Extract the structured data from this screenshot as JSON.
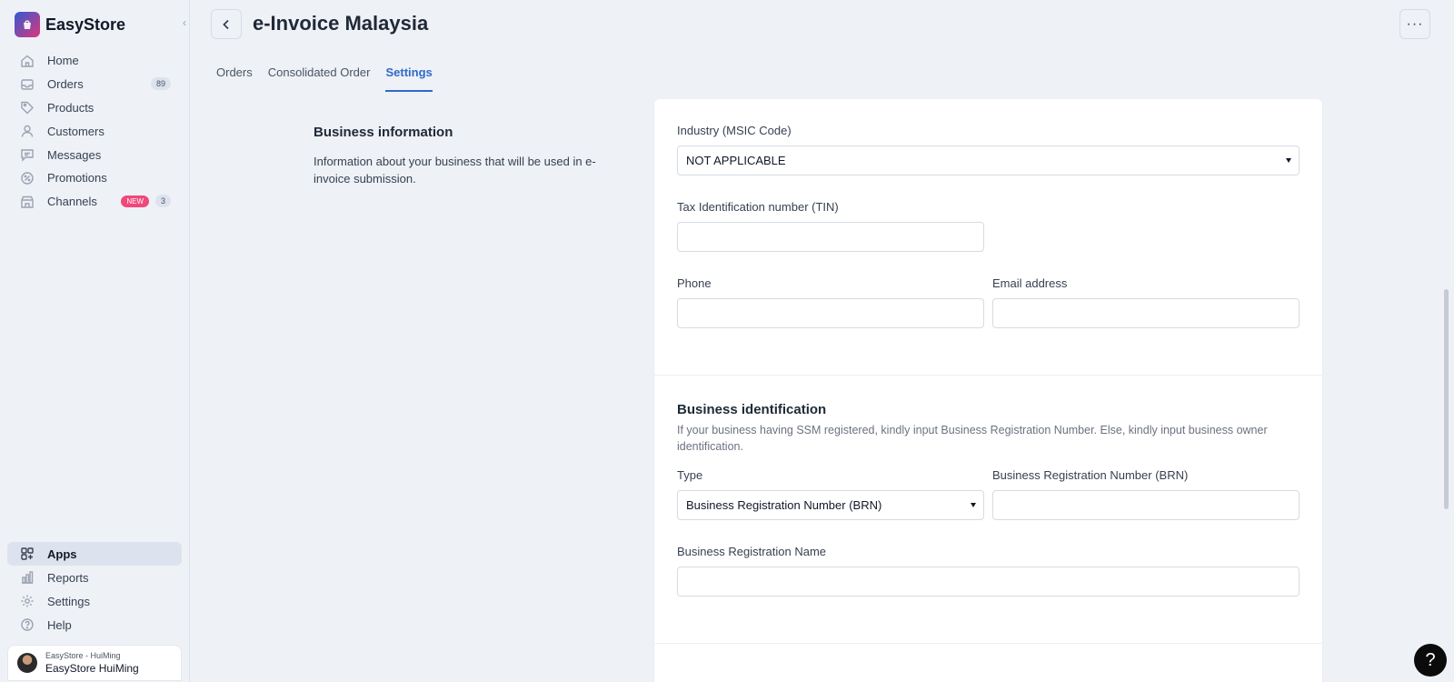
{
  "brand": {
    "name": "EasyStore"
  },
  "sidebar": {
    "items": [
      {
        "label": "Home",
        "icon": "home-icon"
      },
      {
        "label": "Orders",
        "icon": "inbox-icon",
        "count": "89"
      },
      {
        "label": "Products",
        "icon": "tag-icon"
      },
      {
        "label": "Customers",
        "icon": "user-icon"
      },
      {
        "label": "Messages",
        "icon": "chat-icon"
      },
      {
        "label": "Promotions",
        "icon": "discount-icon"
      },
      {
        "label": "Channels",
        "icon": "store-icon",
        "badge": "NEW",
        "count": "3"
      }
    ],
    "bottom_items": [
      {
        "label": "Apps",
        "icon": "apps-icon",
        "active": true
      },
      {
        "label": "Reports",
        "icon": "chart-icon"
      },
      {
        "label": "Settings",
        "icon": "gear-icon"
      },
      {
        "label": "Help",
        "icon": "question-icon"
      }
    ],
    "account": {
      "store": "EasyStore - HuiMing",
      "name": "EasyStore HuiMing"
    }
  },
  "header": {
    "title": "e-Invoice Malaysia",
    "more_label": "···",
    "tabs": [
      {
        "label": "Orders"
      },
      {
        "label": "Consolidated Order"
      },
      {
        "label": "Settings",
        "active": true
      }
    ]
  },
  "business_info": {
    "title": "Business information",
    "description": "Information about your business that will be used in e-invoice submission."
  },
  "form": {
    "industry": {
      "label": "Industry (MSIC Code)",
      "value": "NOT APPLICABLE"
    },
    "tin": {
      "label": "Tax Identification number (TIN)",
      "value": ""
    },
    "phone": {
      "label": "Phone",
      "value": ""
    },
    "email": {
      "label": "Email address",
      "value": ""
    }
  },
  "business_identification": {
    "title": "Business identification",
    "description": "If your business having SSM registered, kindly input Business Registration Number. Else, kindly input business owner identification.",
    "type": {
      "label": "Type",
      "value": "Business Registration Number (BRN)"
    },
    "brn": {
      "label": "Business Registration Number (BRN)",
      "value": ""
    },
    "brn_name": {
      "label": "Business Registration Name",
      "value": ""
    }
  },
  "help_fab": {
    "label": "?"
  },
  "colors": {
    "accent": "#2f6ac9",
    "new_badge": "#f0487a",
    "background": "#eef1f6"
  }
}
